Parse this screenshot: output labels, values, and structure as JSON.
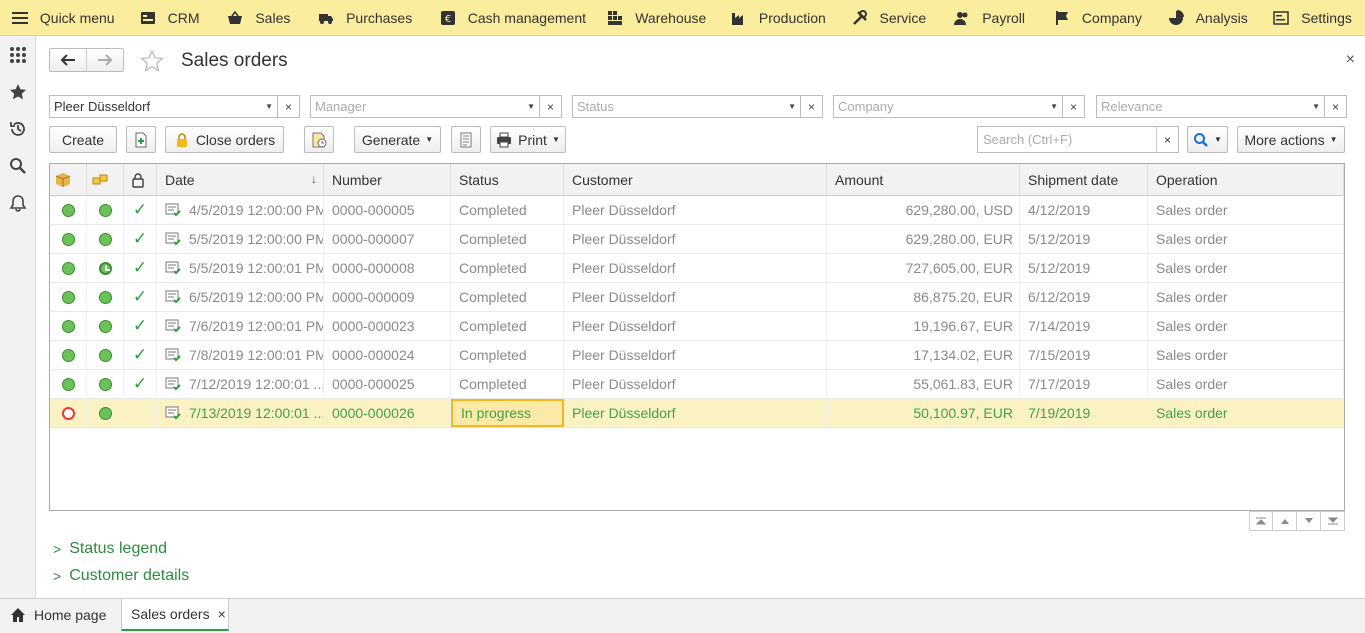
{
  "top_menu": [
    {
      "label": "Quick menu",
      "icon": "hamburger-icon"
    },
    {
      "label": "CRM",
      "icon": "crm-icon"
    },
    {
      "label": "Sales",
      "icon": "basket-icon"
    },
    {
      "label": "Purchases",
      "icon": "truck-icon"
    },
    {
      "label": "Cash management",
      "icon": "coin-icon"
    },
    {
      "label": "Warehouse",
      "icon": "warehouse-icon"
    },
    {
      "label": "Production",
      "icon": "factory-icon"
    },
    {
      "label": "Service",
      "icon": "tools-icon"
    },
    {
      "label": "Payroll",
      "icon": "people-icon"
    },
    {
      "label": "Company",
      "icon": "flag-icon"
    },
    {
      "label": "Analysis",
      "icon": "pie-chart-icon"
    },
    {
      "label": "Settings",
      "icon": "settings-icon"
    }
  ],
  "sidebar": [
    "apps-grid-icon",
    "star-icon",
    "history-icon",
    "search-icon",
    "bell-icon"
  ],
  "form": {
    "title": "Sales orders",
    "close": "×"
  },
  "filters": {
    "counterparty": {
      "value": "Pleer Düsseldorf"
    },
    "manager": {
      "placeholder": "Manager"
    },
    "status": {
      "placeholder": "Status"
    },
    "company": {
      "placeholder": "Company"
    },
    "relevance": {
      "placeholder": "Relevance"
    }
  },
  "commands": {
    "create": "Create",
    "close_orders": "Close orders",
    "generate": "Generate",
    "print": "Print",
    "search_placeholder": "Search (Ctrl+F)",
    "more_actions": "More actions"
  },
  "table": {
    "headers": {
      "date": "Date",
      "number": "Number",
      "status": "Status",
      "customer": "Customer",
      "amount": "Amount",
      "shipment_date": "Shipment date",
      "operation": "Operation"
    },
    "rows": [
      {
        "payment": "paid",
        "shipment": "shipped",
        "closed": true,
        "date": "4/5/2019 12:00:00 PM",
        "number": "0000-000005",
        "status": "Completed",
        "customer": "Pleer Düsseldorf",
        "amount": "629,280.00, USD",
        "shipment_date": "4/12/2019",
        "operation": "Sales order"
      },
      {
        "payment": "paid",
        "shipment": "shipped",
        "closed": true,
        "date": "5/5/2019 12:00:00 PM",
        "number": "0000-000007",
        "status": "Completed",
        "customer": "Pleer Düsseldorf",
        "amount": "629,280.00, EUR",
        "shipment_date": "5/12/2019",
        "operation": "Sales order"
      },
      {
        "payment": "paid",
        "shipment": "partial",
        "closed": true,
        "date": "5/5/2019 12:00:01 PM",
        "number": "0000-000008",
        "status": "Completed",
        "customer": "Pleer Düsseldorf",
        "amount": "727,605.00, EUR",
        "shipment_date": "5/12/2019",
        "operation": "Sales order"
      },
      {
        "payment": "paid",
        "shipment": "shipped",
        "closed": true,
        "date": "6/5/2019 12:00:00 PM",
        "number": "0000-000009",
        "status": "Completed",
        "customer": "Pleer Düsseldorf",
        "amount": "86,875.20, EUR",
        "shipment_date": "6/12/2019",
        "operation": "Sales order"
      },
      {
        "payment": "paid",
        "shipment": "shipped",
        "closed": true,
        "date": "7/6/2019 12:00:01 PM",
        "number": "0000-000023",
        "status": "Completed",
        "customer": "Pleer Düsseldorf",
        "amount": "19,196.67, EUR",
        "shipment_date": "7/14/2019",
        "operation": "Sales order"
      },
      {
        "payment": "paid",
        "shipment": "shipped",
        "closed": true,
        "date": "7/8/2019 12:00:01 PM",
        "number": "0000-000024",
        "status": "Completed",
        "customer": "Pleer Düsseldorf",
        "amount": "17,134.02, EUR",
        "shipment_date": "7/15/2019",
        "operation": "Sales order"
      },
      {
        "payment": "paid",
        "shipment": "shipped",
        "closed": true,
        "date": "7/12/2019 12:00:01 ...",
        "number": "0000-000025",
        "status": "Completed",
        "customer": "Pleer Düsseldorf",
        "amount": "55,061.83, EUR",
        "shipment_date": "7/17/2019",
        "operation": "Sales order"
      },
      {
        "payment": "unpaid",
        "shipment": "shipped",
        "closed": false,
        "date": "7/13/2019 12:00:01 ...",
        "number": "0000-000026",
        "status": "In progress",
        "customer": "Pleer Düsseldorf",
        "amount": "50,100.97, EUR",
        "shipment_date": "7/19/2019",
        "operation": "Sales order"
      }
    ]
  },
  "sections": {
    "status_legend": "Status legend",
    "customer_details": "Customer details"
  },
  "bottom_tabs": {
    "home": "Home page",
    "sales_orders": "Sales orders",
    "close": "×"
  },
  "colors": {
    "menu_bg": "#fbed9e",
    "accent_green": "#2e9e3a",
    "selected_row": "#fbf2c4"
  }
}
